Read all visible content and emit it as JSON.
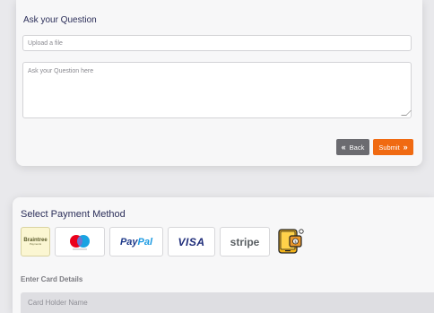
{
  "question": {
    "title": "Ask your Question",
    "upload_placeholder": "Upload a file",
    "question_placeholder": "Ask your Question here",
    "back_label": "Back",
    "submit_label": "Submit"
  },
  "payment": {
    "title": "Select Payment Method",
    "methods": [
      {
        "name": "braintree",
        "label": "Braintree",
        "sublabel": "Payments",
        "icon": "braintree-logo"
      },
      {
        "name": "mastercard",
        "label": "mastercard",
        "icon": "mastercard-logo"
      },
      {
        "name": "paypal",
        "label_a": "Pay",
        "label_b": "Pal",
        "icon": "paypal-logo"
      },
      {
        "name": "visa",
        "label": "VISA",
        "icon": "visa-logo"
      },
      {
        "name": "stripe",
        "label": "stripe",
        "icon": "stripe-logo"
      },
      {
        "name": "wallet",
        "icon": "wallet-icon"
      }
    ],
    "card_details_label": "Enter Card Details",
    "card_holder_placeholder": "Card Holder Name"
  },
  "colors": {
    "accent": "#f06a12",
    "back_button": "#6b6b70",
    "title_text": "#2c2f5a"
  }
}
